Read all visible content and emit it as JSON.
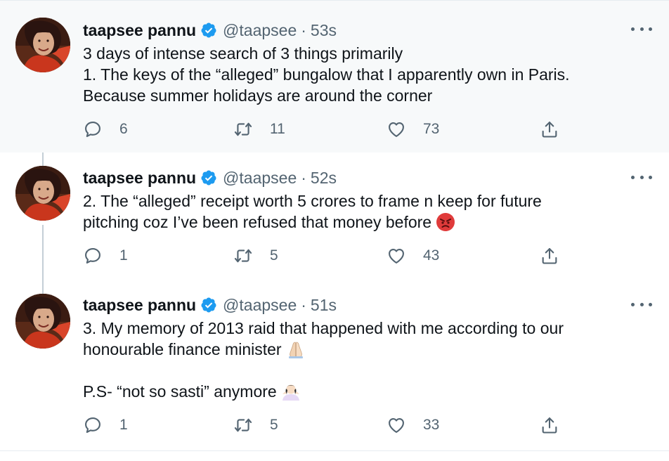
{
  "colors": {
    "background_highlight": "#f7f9fa",
    "text_primary": "#0f1419",
    "text_secondary": "#536471",
    "verified_blue": "#1d9bf0",
    "thread_line": "#c4cfd6"
  },
  "icons": {
    "verified": "verified-badge-icon",
    "more": "more-dots-icon",
    "reply": "reply-icon",
    "retweet": "retweet-icon",
    "like": "heart-icon",
    "share": "share-icon"
  },
  "tweets": [
    {
      "author": "taapsee pannu",
      "handle": "@taapsee",
      "separator": "·",
      "time": "53s",
      "lines": [
        "3 days of intense search of 3 things primarily",
        "1. The keys of the “alleged” bungalow that I apparently own in Paris.",
        "Because summer holidays are around the corner"
      ],
      "replies": "6",
      "retweets": "11",
      "likes": "73"
    },
    {
      "author": "taapsee pannu",
      "handle": "@taapsee",
      "separator": "·",
      "time": "52s",
      "lines": [
        "2. The “alleged” receipt worth 5 crores to frame n keep for future",
        "pitching coz I’ve been refused that money before"
      ],
      "emoji": "angry-face-emoji",
      "replies": "1",
      "retweets": "5",
      "likes": "43"
    },
    {
      "author": "taapsee pannu",
      "handle": "@taapsee",
      "separator": "·",
      "time": "51s",
      "lines": [
        "3. My memory of 2013 raid that happened with me according to our",
        "honourable finance minister"
      ],
      "emoji_line2": "folded-hands-emoji",
      "ps_line": "P.S- “not so sasti” anymore",
      "emoji_ps": "person-shrugging-emoji",
      "replies": "1",
      "retweets": "5",
      "likes": "33"
    }
  ]
}
